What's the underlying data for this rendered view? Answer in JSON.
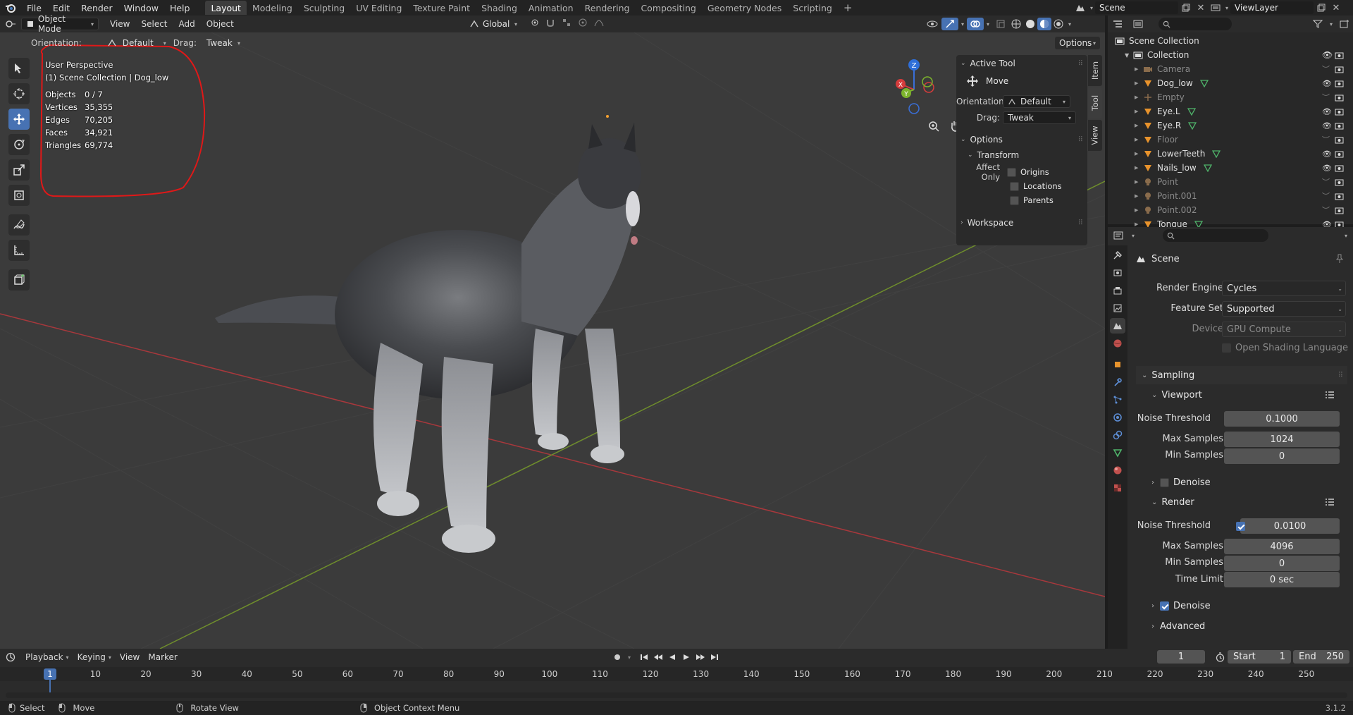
{
  "topbar": {
    "menus": [
      "File",
      "Edit",
      "Render",
      "Window",
      "Help"
    ],
    "tabs": [
      "Layout",
      "Modeling",
      "Sculpting",
      "UV Editing",
      "Texture Paint",
      "Shading",
      "Animation",
      "Rendering",
      "Compositing",
      "Geometry Nodes",
      "Scripting"
    ],
    "active_tab": "Layout",
    "add_tab": "+",
    "scene": "Scene",
    "view_layer": "ViewLayer"
  },
  "viewport_header": {
    "mode": "Object Mode",
    "menus": [
      "View",
      "Select",
      "Add",
      "Object"
    ],
    "transform_orientation": "Global",
    "options": "Options"
  },
  "tool_settings": {
    "orientation_label": "Orientation:",
    "orientation_value": "Default",
    "drag_label": "Drag:",
    "drag_value": "Tweak"
  },
  "stats": {
    "view": "User Perspective",
    "context": "(1) Scene Collection | Dog_low",
    "rows": [
      {
        "key": "Objects",
        "value": "0 / 7"
      },
      {
        "key": "Vertices",
        "value": "35,355"
      },
      {
        "key": "Edges",
        "value": "70,205"
      },
      {
        "key": "Faces",
        "value": "34,921"
      },
      {
        "key": "Triangles",
        "value": "69,774"
      }
    ]
  },
  "npanel": {
    "tabs": [
      "Item",
      "Tool",
      "View"
    ],
    "active_tool_title": "Active Tool",
    "tool_name": "Move",
    "orientation_label": "Orientation",
    "orientation_value": "Default",
    "drag_label": "Drag:",
    "drag_value": "Tweak",
    "options_title": "Options",
    "transform_title": "Transform",
    "affect_only": "Affect Only",
    "affect_items": [
      "Origins",
      "Locations",
      "Parents"
    ],
    "workspace_title": "Workspace"
  },
  "outliner": {
    "root": "Scene Collection",
    "collection": "Collection",
    "items": [
      {
        "name": "Camera",
        "type": "camera",
        "dim": true
      },
      {
        "name": "Dog_low",
        "type": "mesh",
        "dim": false
      },
      {
        "name": "Empty",
        "type": "empty",
        "dim": true
      },
      {
        "name": "Eye.L",
        "type": "mesh",
        "dim": false
      },
      {
        "name": "Eye.R",
        "type": "mesh",
        "dim": false
      },
      {
        "name": "Floor",
        "type": "mesh",
        "dim": true
      },
      {
        "name": "LowerTeeth",
        "type": "mesh",
        "dim": false
      },
      {
        "name": "Nails_low",
        "type": "mesh",
        "dim": false
      },
      {
        "name": "Point",
        "type": "light",
        "dim": true
      },
      {
        "name": "Point.001",
        "type": "light",
        "dim": true
      },
      {
        "name": "Point.002",
        "type": "light",
        "dim": true
      },
      {
        "name": "Tongue",
        "type": "mesh",
        "dim": false
      }
    ]
  },
  "properties": {
    "context": "Scene",
    "render_engine_label": "Render Engine",
    "render_engine": "Cycles",
    "feature_set_label": "Feature Set",
    "feature_set": "Supported",
    "device_label": "Device",
    "device": "GPU Compute",
    "osl_label": "Open Shading Language",
    "sampling_title": "Sampling",
    "viewport_title": "Viewport",
    "viewport": {
      "noise_threshold_label": "Noise Threshold",
      "noise_threshold": "0.1000",
      "max_samples_label": "Max Samples",
      "max_samples": "1024",
      "min_samples_label": "Min Samples",
      "min_samples": "0",
      "denoise_label": "Denoise"
    },
    "render_title": "Render",
    "render": {
      "noise_threshold_label": "Noise Threshold",
      "noise_threshold": "0.0100",
      "max_samples_label": "Max Samples",
      "max_samples": "4096",
      "min_samples_label": "Min Samples",
      "min_samples": "0",
      "time_limit_label": "Time Limit",
      "time_limit": "0 sec",
      "denoise_label": "Denoise"
    },
    "advanced_title": "Advanced"
  },
  "timeline": {
    "menus": [
      "Playback",
      "Keying",
      "View",
      "Marker"
    ],
    "current_frame": "1",
    "start_label": "Start",
    "start": "1",
    "end_label": "End",
    "end": "250",
    "ruler": [
      "10",
      "20",
      "30",
      "40",
      "50",
      "60",
      "70",
      "80",
      "90",
      "100",
      "110",
      "120",
      "130",
      "140",
      "150",
      "160",
      "170",
      "180",
      "190",
      "200",
      "210",
      "220",
      "230",
      "240",
      "250"
    ],
    "playhead": "1"
  },
  "statusbar": {
    "select": "Select",
    "move": "Move",
    "rotate": "Rotate View",
    "context_menu": "Object Context Menu",
    "version": "3.1.2"
  }
}
